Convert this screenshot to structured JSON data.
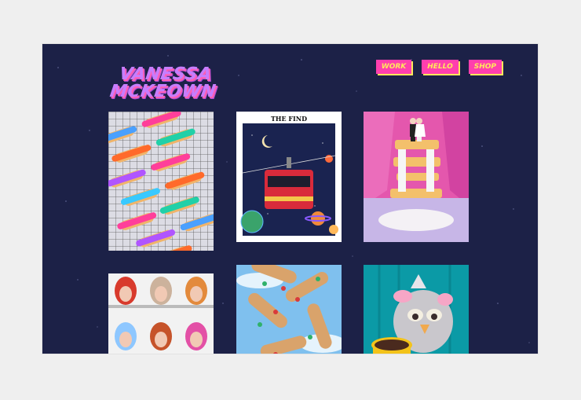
{
  "site": {
    "logo_line1": "VANESSA",
    "logo_line2": "MCKEOWN",
    "nav": [
      "WORK",
      "HELLO",
      "SHOP"
    ]
  },
  "gallery": {
    "tile2_caption": "THE FIND"
  },
  "colors": {
    "background": "#1c2147",
    "nav_bg": "#ff3fae",
    "nav_text": "#ffe95c",
    "logo": "#c77dff"
  }
}
